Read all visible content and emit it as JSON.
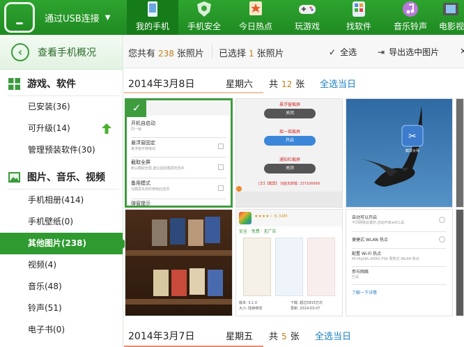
{
  "topbar": {
    "device_label": "通过USB连接",
    "tabs": [
      {
        "label": "我的手机",
        "icon": "phone-manager-icon",
        "active": true
      },
      {
        "label": "手机安全",
        "icon": "shield-icon",
        "active": false
      },
      {
        "label": "今日热点",
        "icon": "star-flag-icon",
        "active": false
      },
      {
        "label": "玩游戏",
        "icon": "gamepad-icon",
        "active": false
      },
      {
        "label": "找软件",
        "icon": "apps-grid-icon",
        "active": false
      },
      {
        "label": "音乐铃声",
        "icon": "music-note-icon",
        "active": false
      },
      {
        "label": "电影视",
        "icon": "film-icon",
        "active": false
      }
    ]
  },
  "sidebar": {
    "overview_label": "查看手机概况",
    "sections": [
      {
        "title": "游戏、软件",
        "icon": "apps-grid-icon",
        "items": [
          {
            "label": "已安装(36)"
          },
          {
            "label": "可升级(14)"
          },
          {
            "label": "管理预装软件(30)"
          }
        ]
      },
      {
        "title": "图片、音乐、视频",
        "icon": "picture-icon",
        "items": [
          {
            "label": "手机相册(414)"
          },
          {
            "label": "手机壁纸(0)"
          },
          {
            "label": "其他图片(238)"
          },
          {
            "label": "视频(4)"
          },
          {
            "label": "音乐(48)"
          },
          {
            "label": "铃声(51)"
          },
          {
            "label": "电子书(0)"
          }
        ]
      }
    ]
  },
  "toolbar": {
    "total_prefix": "您共有",
    "total_count": "238",
    "total_suffix": "张照片",
    "selected_prefix": "已选择",
    "selected_count": "1",
    "selected_suffix": "张照片",
    "select_all_label": "全选",
    "export_label": "导出选中图片"
  },
  "groups": [
    {
      "date": "2014年3月8日",
      "weekday": "星期六",
      "count_prefix": "共",
      "count": "12",
      "count_suffix": "张",
      "select_day_label": "全选当日"
    },
    {
      "date": "2014年3月7日",
      "weekday": "星期五",
      "count_prefix": "共",
      "count": "5",
      "count_suffix": "张",
      "select_day_label": "全选当日"
    }
  ],
  "thumbs": {
    "settings": {
      "rows": [
        {
          "title": "开机自启动",
          "sub": "同一帧"
        },
        {
          "title": "悬浮窗固定",
          "sub": "悬浮窗不随拖动"
        },
        {
          "title": "截取全屏",
          "sub": "默认截取全屏,建议固定截屏时选中"
        },
        {
          "title": "备用模式",
          "sub": "在截屏失败时使用此选项"
        },
        {
          "title": "弹窗提示",
          "sub": ""
        }
      ]
    },
    "toggles": {
      "items": [
        {
          "label": "悬浮窗截屏",
          "state": "关闭"
        },
        {
          "label": "摇一摇截屏",
          "state": "开启"
        },
        {
          "label": "通知栏截屏",
          "state": "关闭"
        }
      ],
      "footer": "[华】【截屏】 功能无卸载: 237106999"
    },
    "bird_app_label": "截屏大师",
    "app_page": {
      "rating": "★★★★☆ 6.34M",
      "badges": [
        "安全",
        "免费",
        "无广告"
      ],
      "version": "版本: 3.1.0",
      "version2": "大小: 陆续修改",
      "downloads": "下载: 超过5815万次",
      "updated": "更新: 2014-03-07"
    },
    "wifi_list": {
      "rows": [
        {
          "title": "自动可以开启",
          "sub": "不同网络设置时,自动开启wifi工具"
        },
        {
          "title": "便捷式 WLAN 热点",
          "sub": ""
        },
        {
          "title": "配置 Wi-Fi 热点",
          "sub": "MI·HighBL-WPA2 PSK 便携式 WLAN 热点"
        },
        {
          "title": "参与网络",
          "sub": "已关"
        }
      ],
      "footer": "了解一下详情"
    }
  },
  "colors": {
    "brand_green": "#2ea42f",
    "active_tab": "#167c19",
    "link_blue": "#1a7fbf",
    "count_orange": "#c0801a"
  }
}
